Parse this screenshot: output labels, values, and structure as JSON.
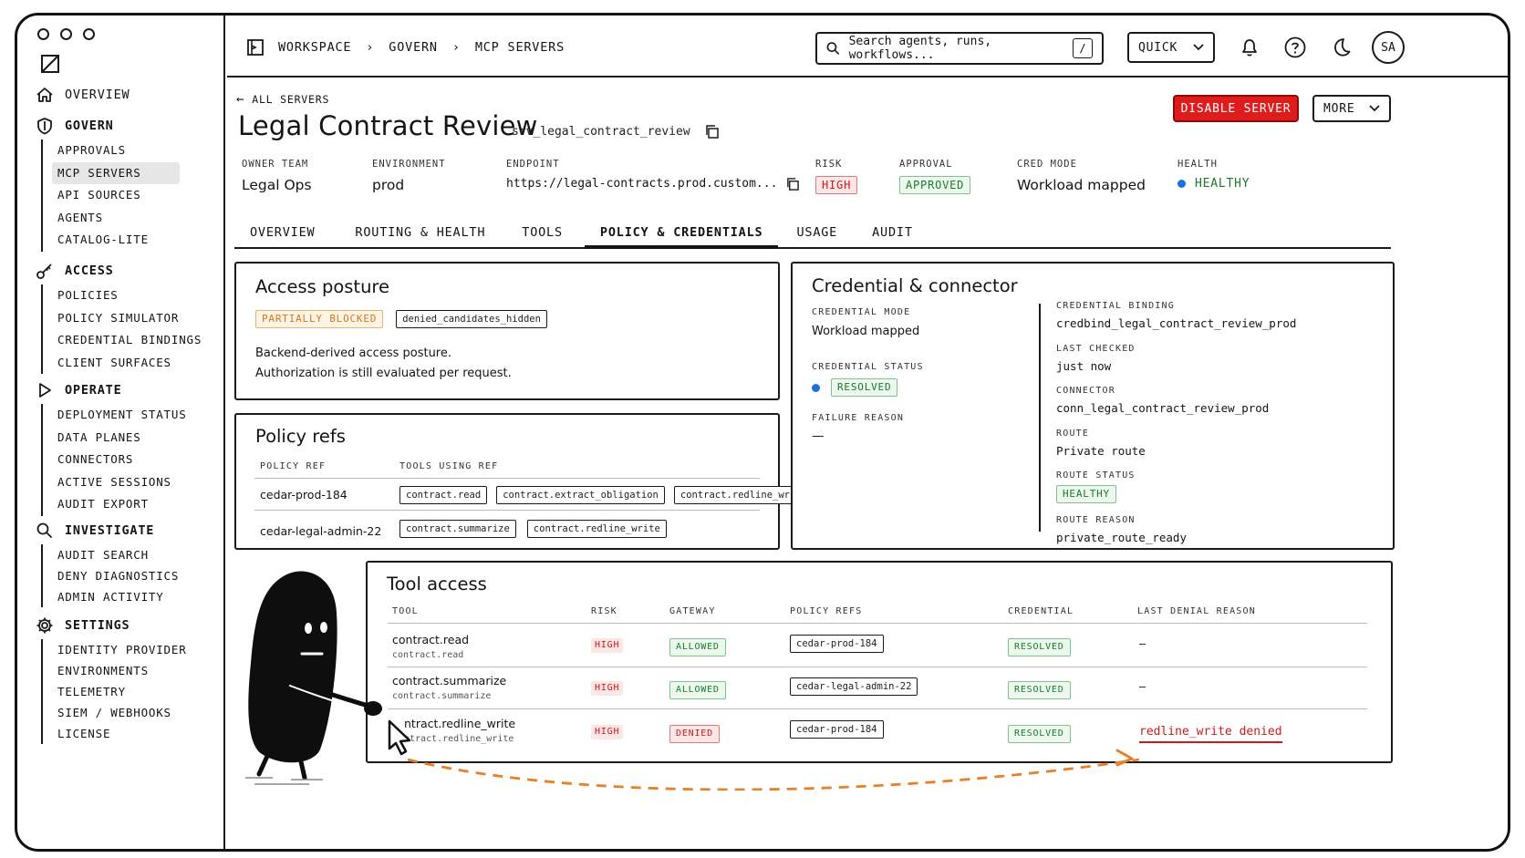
{
  "sidebar": {
    "groups": [
      {
        "label": "OVERVIEW",
        "items": []
      },
      {
        "label": "GOVERN",
        "items": [
          "APPROVALS",
          "MCP SERVERS",
          "API SOURCES",
          "AGENTS",
          "CATALOG-LITE"
        ]
      },
      {
        "label": "ACCESS",
        "items": [
          "POLICIES",
          "POLICY SIMULATOR",
          "CREDENTIAL BINDINGS",
          "CLIENT SURFACES"
        ]
      },
      {
        "label": "OPERATE",
        "items": [
          "DEPLOYMENT STATUS",
          "DATA PLANES",
          "CONNECTORS",
          "ACTIVE SESSIONS",
          "AUDIT EXPORT"
        ]
      },
      {
        "label": "INVESTIGATE",
        "items": [
          "AUDIT SEARCH",
          "DENY DIAGNOSTICS",
          "ADMIN ACTIVITY"
        ]
      },
      {
        "label": "SETTINGS",
        "items": [
          "IDENTITY PROVIDER",
          "ENVIRONMENTS",
          "TELEMETRY",
          "SIEM / WEBHOOKS",
          "LICENSE"
        ]
      }
    ]
  },
  "topbar": {
    "breadcrumbs": [
      "WORKSPACE",
      "GOVERN",
      "MCP SERVERS"
    ],
    "search_placeholder": "Search agents, runs, workflows...",
    "search_shortcut": "/",
    "quick_label": "QUICK",
    "avatar_initials": "SA"
  },
  "header": {
    "back_label": "ALL SERVERS",
    "title": "Legal Contract Review",
    "slug": "srv_legal_contract_review",
    "disable_label": "DISABLE SERVER",
    "more_label": "MORE"
  },
  "meta": {
    "owner_team": {
      "label": "OWNER TEAM",
      "value": "Legal Ops"
    },
    "environment": {
      "label": "ENVIRONMENT",
      "value": "prod"
    },
    "endpoint": {
      "label": "ENDPOINT",
      "value": "https://legal-contracts.prod.custom..."
    },
    "risk": {
      "label": "RISK",
      "value": "HIGH"
    },
    "approval": {
      "label": "APPROVAL",
      "value": "APPROVED"
    },
    "cred_mode": {
      "label": "CRED MODE",
      "value": "Workload mapped"
    },
    "health": {
      "label": "HEALTH",
      "value": "HEALTHY"
    }
  },
  "tabs": [
    "OVERVIEW",
    "ROUTING & HEALTH",
    "TOOLS",
    "POLICY & CREDENTIALS",
    "USAGE",
    "AUDIT"
  ],
  "active_tab": "POLICY & CREDENTIALS",
  "access_posture": {
    "title": "Access posture",
    "status": "PARTIALLY BLOCKED",
    "tag": "denied_candidates_hidden",
    "line1": "Backend-derived access posture.",
    "line2": "Authorization is still evaluated per request."
  },
  "policy_refs": {
    "title": "Policy refs",
    "col_ref": "POLICY REF",
    "col_tools": "TOOLS USING REF",
    "rows": [
      {
        "ref": "cedar-prod-184",
        "tools": [
          "contract.read",
          "contract.extract_obligation",
          "contract.redline_write"
        ]
      },
      {
        "ref": "cedar-legal-admin-22",
        "tools": [
          "contract.summarize",
          "contract.redline_write"
        ]
      }
    ]
  },
  "credential": {
    "title": "Credential & connector",
    "mode_label": "CREDENTIAL MODE",
    "mode_value": "Workload mapped",
    "status_label": "CREDENTIAL STATUS",
    "status_value": "RESOLVED",
    "failure_label": "FAILURE REASON",
    "failure_value": "—",
    "binding_label": "CREDENTIAL BINDING",
    "binding_value": "credbind_legal_contract_review_prod",
    "checked_label": "LAST CHECKED",
    "checked_value": "just now",
    "connector_label": "CONNECTOR",
    "connector_value": "conn_legal_contract_review_prod",
    "route_label": "ROUTE",
    "route_value": "Private route",
    "route_status_label": "ROUTE STATUS",
    "route_status_value": "HEALTHY",
    "route_reason_label": "ROUTE REASON",
    "route_reason_value": "private_route_ready"
  },
  "tool_access": {
    "title": "Tool access",
    "columns": [
      "TOOL",
      "RISK",
      "GATEWAY",
      "POLICY REFS",
      "CREDENTIAL",
      "LAST DENIAL REASON"
    ],
    "rows": [
      {
        "tool": "contract.read",
        "sub": "contract.read",
        "risk": "HIGH",
        "gateway": "ALLOWED",
        "policy": "cedar-prod-184",
        "credential": "RESOLVED",
        "reason": "–"
      },
      {
        "tool": "contract.summarize",
        "sub": "contract.summarize",
        "risk": "HIGH",
        "gateway": "ALLOWED",
        "policy": "cedar-legal-admin-22",
        "credential": "RESOLVED",
        "reason": "–"
      },
      {
        "tool": "ntract.redline_write",
        "sub": "ntract.redline_write",
        "risk": "HIGH",
        "gateway": "DENIED",
        "policy": "cedar-prod-184",
        "credential": "RESOLVED",
        "reason": "redline_write denied"
      }
    ]
  },
  "colors": {
    "danger": "#df1c1c",
    "ok": "#1a7a2a",
    "warn": "#d7761a",
    "dot": "#1f6fe0",
    "arrow": "#e8802a"
  }
}
